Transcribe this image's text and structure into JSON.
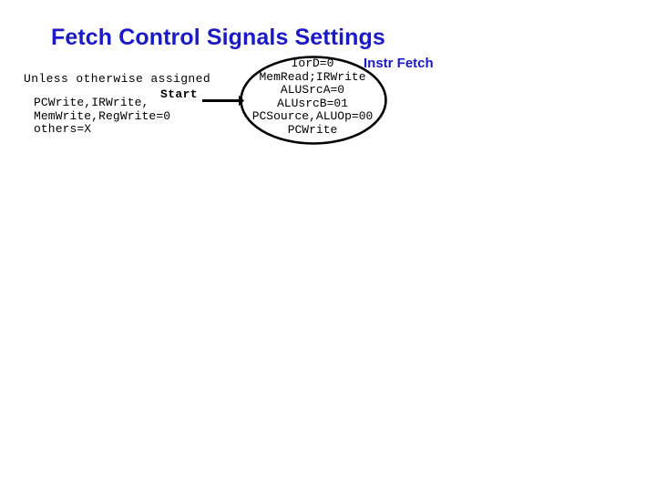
{
  "slide": {
    "title": "Fetch Control Signals Settings",
    "title_color": "#1a1ac8",
    "background_color": "#ffffff",
    "stroke_color": "#000000"
  },
  "default_assignments": {
    "heading": "Unless otherwise assigned",
    "lines": [
      "PCWrite,IRWrite,",
      "MemWrite,RegWrite=0",
      "others=X"
    ],
    "body_text": "PCWrite,IRWrite,\nMemWrite,RegWrite=0\nothers=X"
  },
  "start_transition": {
    "label": "Start",
    "arrow_icon": "arrow-right-icon"
  },
  "state": {
    "name": "Instr Fetch",
    "name_color": "#1a1ac8",
    "shape": "ellipse",
    "signal_lines": [
      "IorD=0",
      "MemRead;IRWrite",
      "ALUSrcA=0",
      "ALUsrcB=01",
      "PCSource,ALUOp=00",
      "PCWrite"
    ],
    "line_0": "IorD=0",
    "line_1": "MemRead;IRWrite",
    "line_2": "ALUSrcA=0",
    "line_3": "ALUsrcB=01",
    "line_4": "PCSource,ALUOp=00",
    "line_5": "PCWrite"
  }
}
